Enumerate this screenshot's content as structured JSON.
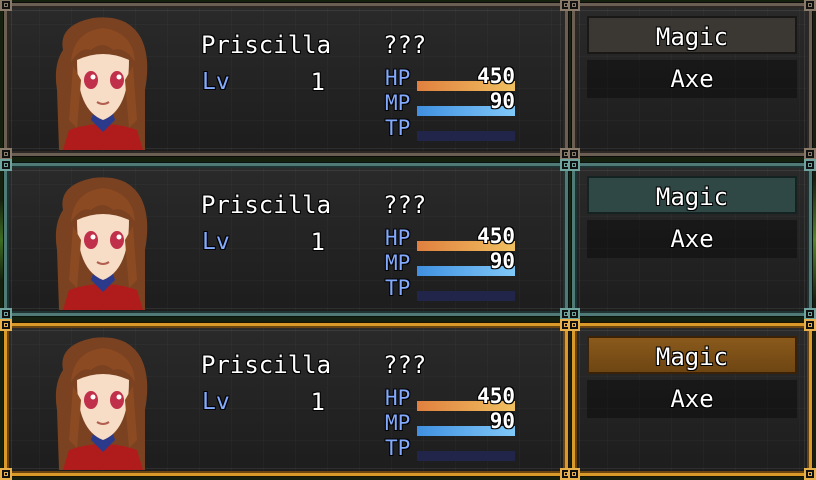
{
  "rows": [
    {
      "actor": {
        "name": "Priscilla",
        "class": "???",
        "lv_label": "Lv",
        "level": "1"
      },
      "gauges": {
        "hp": {
          "label": "HP",
          "value": "450",
          "fill": 1.0
        },
        "mp": {
          "label": "MP",
          "value": "90",
          "fill": 1.0
        },
        "tp": {
          "label": "TP",
          "value": "",
          "fill": 0.0
        }
      },
      "commands": {
        "magic": "Magic",
        "axe": "Axe"
      },
      "frame_color": "#6b5e52"
    },
    {
      "actor": {
        "name": "Priscilla",
        "class": "???",
        "lv_label": "Lv",
        "level": "1"
      },
      "gauges": {
        "hp": {
          "label": "HP",
          "value": "450",
          "fill": 1.0
        },
        "mp": {
          "label": "MP",
          "value": "90",
          "fill": 1.0
        },
        "tp": {
          "label": "TP",
          "value": "",
          "fill": 0.0
        }
      },
      "commands": {
        "magic": "Magic",
        "axe": "Axe"
      },
      "frame_color": "#4f7a76"
    },
    {
      "actor": {
        "name": "Priscilla",
        "class": "???",
        "lv_label": "Lv",
        "level": "1"
      },
      "gauges": {
        "hp": {
          "label": "HP",
          "value": "450",
          "fill": 1.0
        },
        "mp": {
          "label": "MP",
          "value": "90",
          "fill": 1.0
        },
        "tp": {
          "label": "TP",
          "value": "",
          "fill": 0.0
        }
      },
      "commands": {
        "magic": "Magic",
        "axe": "Axe"
      },
      "frame_color": "#d99a2a"
    }
  ],
  "colors": {
    "system_text": "#84aaff",
    "hp_gauge": "#e0803f",
    "mp_gauge": "#4090e0",
    "gauge_back": "#22254a"
  }
}
